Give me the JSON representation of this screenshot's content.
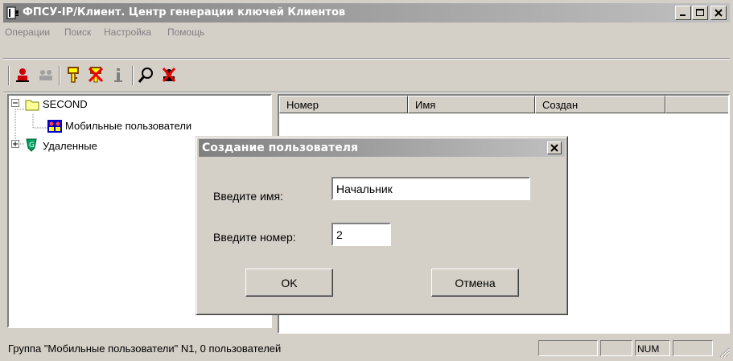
{
  "window": {
    "title": "ФПСУ-IP/Клиент. Центр генерации ключей Клиентов",
    "icon": "app-doc-icon",
    "controls": [
      "minimize-icon",
      "maximize-icon",
      "close-icon"
    ]
  },
  "menu": {
    "items": [
      "Операции",
      "Поиск",
      "Настройка",
      "Помощь"
    ]
  },
  "toolbar": {
    "buttons": [
      "add-user-icon",
      "users-group-icon",
      "key-icon",
      "delete-key-icon",
      "info-icon",
      "search-icon",
      "remove-user-icon"
    ]
  },
  "tree": {
    "root": "SECOND",
    "child": "Мобильные пользователи",
    "second": "Удаленные"
  },
  "list": {
    "columns": [
      "Номер",
      "Имя",
      "Создан"
    ]
  },
  "dialog": {
    "title": "Создание пользователя",
    "name_label": "Введите имя:",
    "name_value": "Начальник",
    "number_label": "Введите номер:",
    "number_value": "2",
    "ok_label": "OK",
    "cancel_label": "Отмена"
  },
  "status": {
    "text": "Группа \"Мобильные пользователи\" N1, 0 пользователей",
    "num": "NUM"
  },
  "colors": {
    "titlebar_inactive_start": "#808080",
    "titlebar_inactive_end": "#c0c0c0",
    "face": "#d4d0c8"
  }
}
